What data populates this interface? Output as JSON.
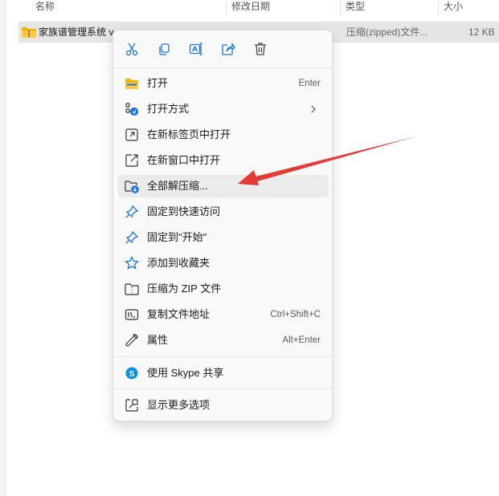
{
  "columns": {
    "name": "名称",
    "modified": "修改日期",
    "type": "类型",
    "size": "大小"
  },
  "file": {
    "name": "家族谱管理系统 v",
    "type": "压缩(zipped)文件...",
    "size": "12 KB"
  },
  "context_menu": {
    "toolbar": [
      "cut-icon",
      "copy-icon",
      "rename-icon",
      "share-icon",
      "delete-icon"
    ],
    "items": [
      {
        "label": "打开",
        "shortcut": "Enter",
        "icon": "folder-icon"
      },
      {
        "label": "打开方式",
        "submenu": true,
        "icon": "open-with-icon"
      },
      {
        "label": "在新标签页中打开",
        "icon": "new-tab-icon"
      },
      {
        "label": "在新窗口中打开",
        "icon": "new-window-icon"
      },
      {
        "label": "全部解压缩...",
        "icon": "extract-icon"
      },
      {
        "label": "固定到快速访问",
        "icon": "pin-icon"
      },
      {
        "label": "固定到\"开始\"",
        "icon": "pin-icon"
      },
      {
        "label": "添加到收藏夹",
        "icon": "star-icon"
      },
      {
        "label": "压缩为 ZIP 文件",
        "icon": "zip-icon"
      },
      {
        "label": "复制文件地址",
        "shortcut": "Ctrl+Shift+C",
        "icon": "copy-path-icon"
      },
      {
        "label": "属性",
        "shortcut": "Alt+Enter",
        "icon": "wrench-icon"
      },
      {
        "label": "使用 Skype 共享",
        "icon": "skype-icon"
      },
      {
        "label": "显示更多选项",
        "icon": "more-options-icon"
      }
    ]
  },
  "colors": {
    "accent": "#1a73e8",
    "arrow": "#e53935",
    "folder": "#f0b400",
    "skype": "#0a8fe5"
  }
}
